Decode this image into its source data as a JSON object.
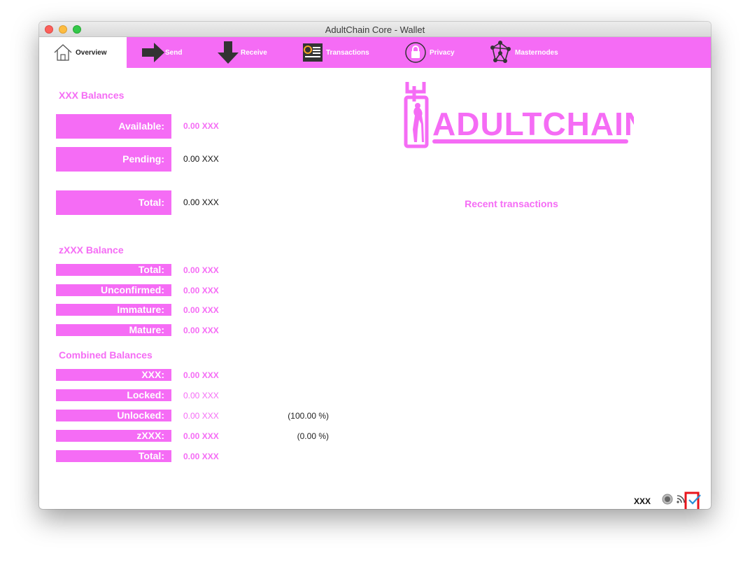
{
  "window": {
    "title": "AdultChain Core - Wallet"
  },
  "tabs": [
    {
      "label": "Overview",
      "icon": "home-icon",
      "active": true
    },
    {
      "label": "Send",
      "icon": "arrow-right-icon"
    },
    {
      "label": "Receive",
      "icon": "arrow-down-icon"
    },
    {
      "label": "Transactions",
      "icon": "transactions-icon"
    },
    {
      "label": "Privacy",
      "icon": "lock-icon"
    },
    {
      "label": "Masternodes",
      "icon": "network-icon"
    }
  ],
  "balances": {
    "title": "XXX Balances",
    "available_label": "Available:",
    "available_value": "0.00 XXX",
    "pending_label": "Pending:",
    "pending_value": "0.00 XXX",
    "total_label": "Total:",
    "total_value": "0.00 XXX"
  },
  "zbalance": {
    "title": "zXXX Balance",
    "total_label": "Total:",
    "total_value": "0.00 XXX",
    "unconfirmed_label": "Unconfirmed:",
    "unconfirmed_value": "0.00 XXX",
    "immature_label": "Immature:",
    "immature_value": "0.00 XXX",
    "mature_label": "Mature:",
    "mature_value": "0.00 XXX"
  },
  "combined": {
    "title": "Combined Balances",
    "xxx_label": "XXX:",
    "xxx_value": "0.00 XXX",
    "locked_label": "Locked:",
    "locked_value": "0.00 XXX",
    "unlocked_label": "Unlocked:",
    "unlocked_value": "0.00 XXX",
    "unlocked_pct": "(100.00 %)",
    "zxxx_label": "zXXX:",
    "zxxx_value": "0.00 XXX",
    "zxxx_pct": "(0.00 %)",
    "total_label": "Total:",
    "total_value": "0.00 XXX"
  },
  "logo": {
    "text": "ADULTCHAIN"
  },
  "recent": {
    "title": "Recent transactions"
  },
  "statusbar": {
    "unit": "XXX",
    "icons": [
      "staking-icon",
      "connections-icon",
      "synced-check-icon"
    ]
  },
  "colors": {
    "accent": "#f56cf5",
    "annotation": "#e8141b"
  }
}
